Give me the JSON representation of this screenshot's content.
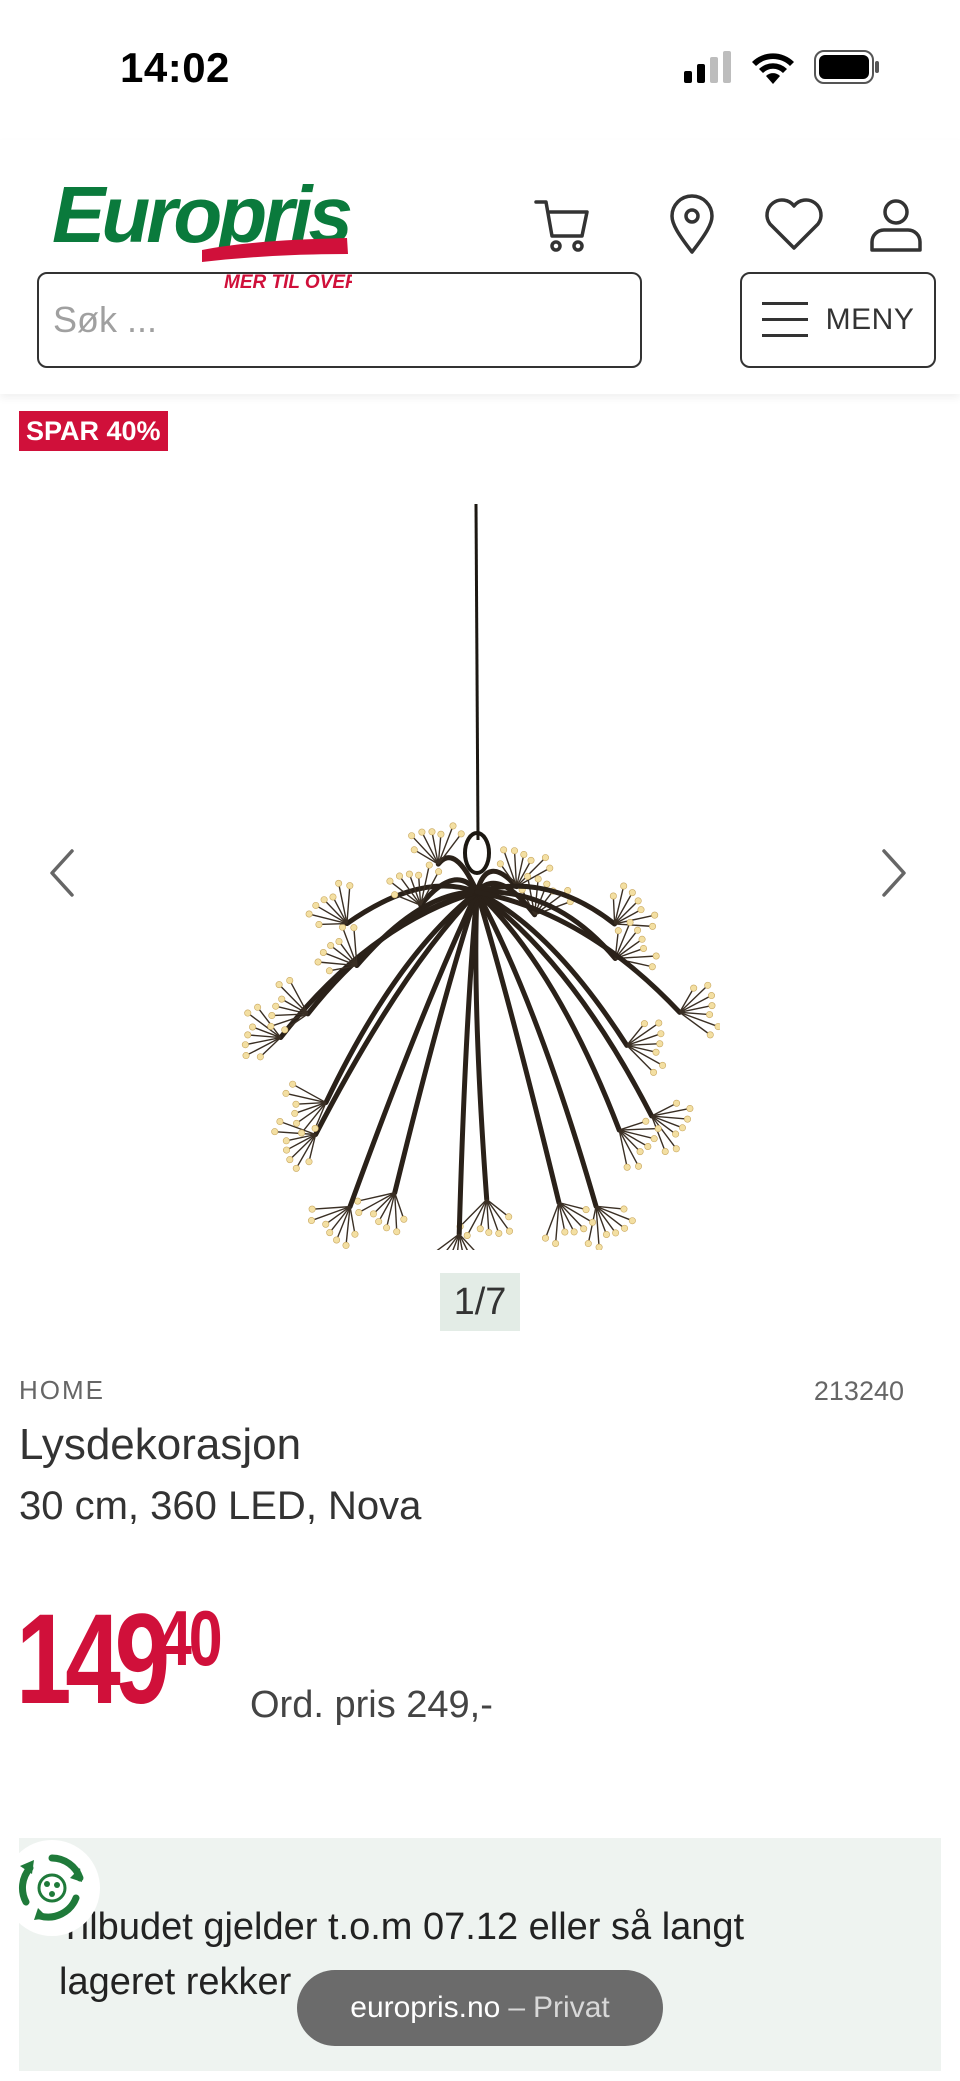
{
  "status_bar": {
    "time": "14:02",
    "icons": [
      "signal-icon",
      "wifi-icon",
      "battery-icon"
    ]
  },
  "header": {
    "logo": {
      "name": "Europris",
      "tagline": "MER TIL OVERS"
    },
    "icons": [
      "cart-icon",
      "location-icon",
      "heart-icon",
      "user-icon"
    ],
    "search": {
      "placeholder": "Søk ...",
      "value": ""
    },
    "menu_label": "MENY"
  },
  "product": {
    "badge": "SPAR 40%",
    "image_counter": "1/7",
    "brand": "HOME",
    "sku": "213240",
    "title": "Lysdekorasjon",
    "subtitle": "30 cm, 360 LED, Nova",
    "price_main": "149",
    "price_cents": "40",
    "ordinary_price": "Ord. pris 249,-"
  },
  "offer": {
    "text": "Tilbudet gjelder t.o.m 07.12 eller så langt lageret rekker"
  },
  "browser": {
    "domain": "europris.no",
    "separator": "–",
    "mode": "Privat"
  },
  "colors": {
    "brand_green": "#0a7a3c",
    "brand_red": "#d0103a",
    "offer_bg": "#eef3f0"
  }
}
